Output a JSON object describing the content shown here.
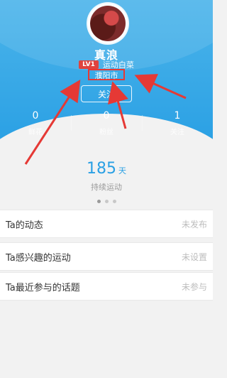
{
  "profile": {
    "name": "真浪",
    "level_badge": "LV1",
    "level_title": "运动白菜",
    "location": "濮阳市",
    "follow_label": "关注"
  },
  "stats": [
    {
      "value": "0",
      "label": "鲜花"
    },
    {
      "value": "0",
      "label": "粉丝"
    },
    {
      "value": "1",
      "label": "关注"
    }
  ],
  "activity": {
    "days_value": "185",
    "days_unit": "天",
    "days_label": "持续运动"
  },
  "pager": {
    "count": 3,
    "active_index": 0
  },
  "list": [
    {
      "title": "Ta的动态",
      "value": "未发布"
    },
    {
      "title": "Ta感兴趣的运动",
      "value": "未设置"
    },
    {
      "title": "Ta最近参与的话题",
      "value": "未参与"
    }
  ],
  "colors": {
    "accent": "#2aa0e4",
    "badge": "#e0433e",
    "annotation": "#e53935"
  }
}
